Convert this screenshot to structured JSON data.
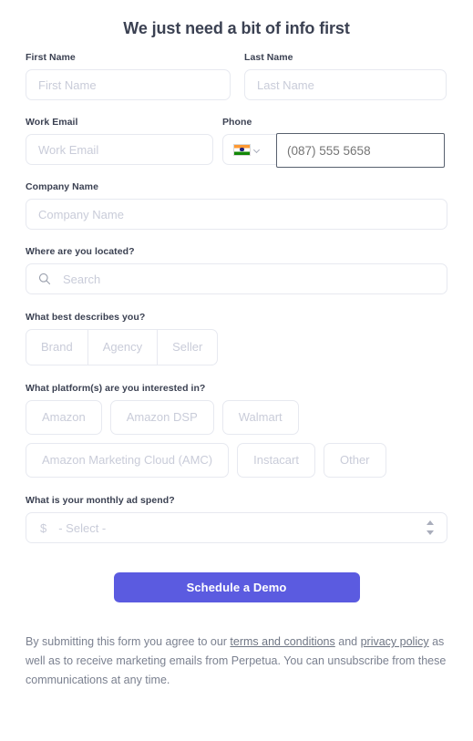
{
  "form": {
    "title": "We just need a bit of info first",
    "fields": {
      "first_name": {
        "label": "First Name",
        "placeholder": "First Name",
        "value": ""
      },
      "last_name": {
        "label": "Last Name",
        "placeholder": "Last Name",
        "value": ""
      },
      "work_email": {
        "label": "Work Email",
        "placeholder": "Work Email",
        "value": ""
      },
      "phone": {
        "label": "Phone",
        "placeholder": "(087) 555 5658",
        "value": "",
        "country_flag": "india-flag-icon"
      },
      "company_name": {
        "label": "Company Name",
        "placeholder": "Company Name",
        "value": ""
      },
      "location": {
        "label": "Where are you located?",
        "placeholder": "Search",
        "value": "",
        "icon": "search-icon"
      }
    },
    "describes_you": {
      "label": "What best describes you?",
      "options": [
        "Brand",
        "Agency",
        "Seller"
      ]
    },
    "platforms": {
      "label": "What platform(s) are you interested in?",
      "options": [
        "Amazon",
        "Amazon DSP",
        "Walmart",
        "Amazon Marketing Cloud (AMC)",
        "Instacart",
        "Other"
      ]
    },
    "ad_spend": {
      "label": "What is your monthly ad spend?",
      "prefix": "$",
      "selected": "- Select -"
    },
    "submit_label": "Schedule a Demo"
  },
  "footer": {
    "text_before": "By submitting this form you agree to our ",
    "terms_link": "terms and conditions",
    "text_middle": " and ",
    "privacy_link": "privacy policy",
    "text_after": " as well as to receive marketing emails from Perpetua. You can unsubscribe from these communications at any time."
  },
  "colors": {
    "accent": "#5b5be0",
    "label": "#3b4152",
    "placeholder": "#c9ccd9",
    "border": "#e7e9f0",
    "footer_text": "#7b8190"
  }
}
